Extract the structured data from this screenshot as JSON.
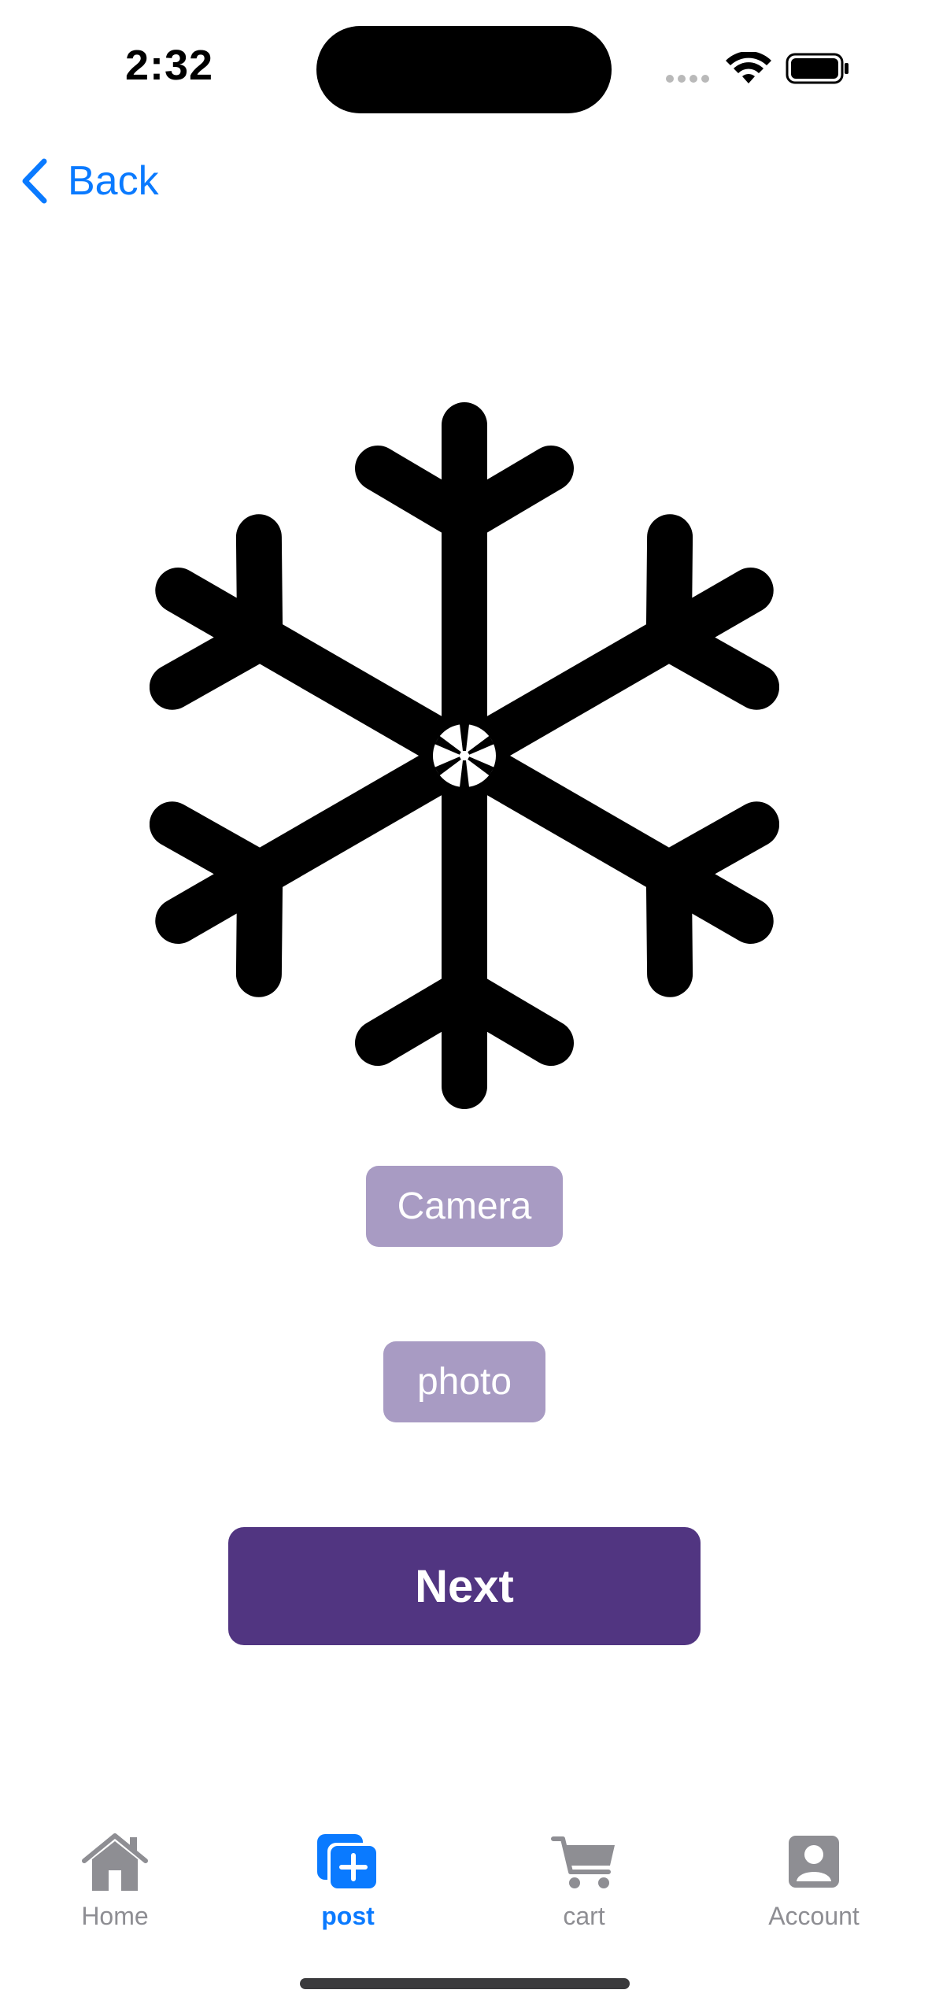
{
  "status_bar": {
    "time": "2:32"
  },
  "nav": {
    "back_label": "Back"
  },
  "main": {
    "icon": "snowflake-icon",
    "camera_label": "Camera",
    "photo_label": "photo",
    "next_label": "Next"
  },
  "tab_bar": {
    "items": [
      {
        "label": "Home",
        "icon": "house-icon",
        "active": false
      },
      {
        "label": "post",
        "icon": "plus-square-icon",
        "active": true
      },
      {
        "label": "cart",
        "icon": "cart-icon",
        "active": false
      },
      {
        "label": "Account",
        "icon": "person-square-icon",
        "active": false
      }
    ]
  },
  "colors": {
    "accent": "#0a7aff",
    "chip_bg": "#a89bc3",
    "primary_button": "#513581",
    "tab_inactive": "#8e8e93"
  }
}
